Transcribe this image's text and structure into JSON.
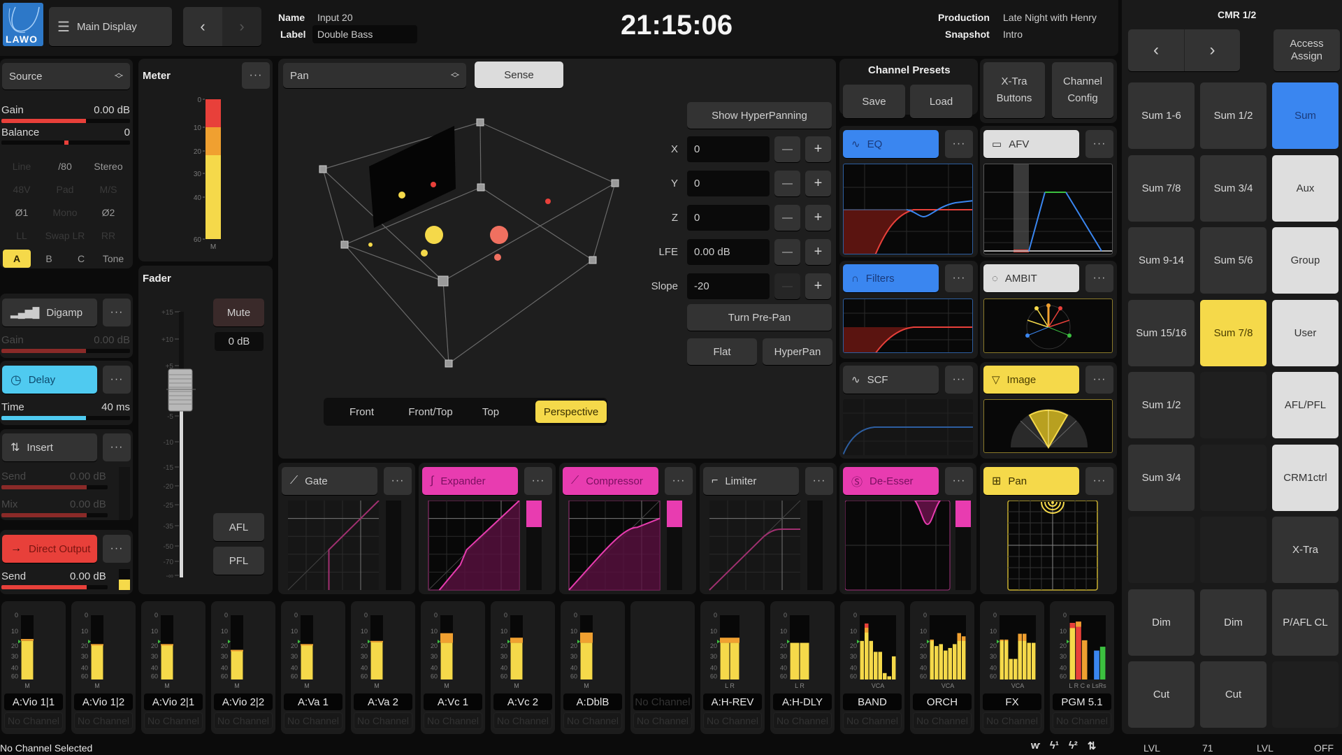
{
  "header": {
    "logo": "LAWO",
    "main_display_label": "Main Display",
    "name_label": "Name",
    "name_value": "Input 20",
    "label_label": "Label",
    "label_value": "Double Bass",
    "clock": "21:15:06",
    "production_label": "Production",
    "production_value": "Late Night with Henry",
    "snapshot_label": "Snapshot",
    "snapshot_value": "Intro"
  },
  "source": {
    "selector": "Source",
    "gain_label": "Gain",
    "gain_value": "0.00 dB",
    "gain_fraction": 0.66,
    "balance_label": "Balance",
    "balance_value": "0",
    "grid": [
      [
        {
          "label": "Line",
          "active": false
        },
        {
          "label": "/80",
          "active": true
        },
        {
          "label": "Stereo",
          "active": true
        }
      ],
      [
        {
          "label": "48V",
          "active": false
        },
        {
          "label": "Pad",
          "active": false
        },
        {
          "label": "M/S",
          "active": false
        }
      ],
      [
        {
          "label": "Ø1",
          "active": true
        },
        {
          "label": "Mono",
          "active": false
        },
        {
          "label": "Ø2",
          "active": true
        }
      ],
      [
        {
          "label": "LL",
          "active": false
        },
        {
          "label": "Swap LR",
          "active": false
        },
        {
          "label": "RR",
          "active": false
        }
      ],
      [
        {
          "label": "A",
          "active": true,
          "selected": true
        },
        {
          "label": "B",
          "active": true
        },
        {
          "label": "C",
          "active": true
        },
        {
          "label": "Tone",
          "active": true
        }
      ]
    ]
  },
  "meter": {
    "title": "Meter",
    "more": "···",
    "scale": [
      "0",
      "10",
      "20",
      "30",
      "40",
      "60"
    ],
    "channel_label": "M"
  },
  "digamp": {
    "label": "Digamp",
    "gain_label": "Gain",
    "gain_value": "0.00 dB",
    "gain_fraction": 0.66
  },
  "delay": {
    "label": "Delay",
    "time_label": "Time",
    "time_value": "40 ms",
    "time_fraction": 0.66
  },
  "insert": {
    "label": "Insert",
    "send_label": "Send",
    "send_value": "0.00 dB",
    "mix_label": "Mix",
    "mix_value": "0.00 dB",
    "send_fraction": 0.8,
    "mix_fraction": 0.8
  },
  "direct_output": {
    "label": "Direct Output",
    "send_label": "Send",
    "send_value": "0.00 dB",
    "send_fraction": 0.8
  },
  "fader": {
    "title": "Fader",
    "scale": [
      "+15",
      "+10",
      "+5",
      "0",
      "-5",
      "-10",
      "-15",
      "-20",
      "-25",
      "-35",
      "-50",
      "-70",
      "-∞"
    ],
    "mute_label": "Mute",
    "level_readout": "0 dB",
    "afl_label": "AFL",
    "pfl_label": "PFL"
  },
  "pan": {
    "selector": "Pan",
    "sense_label": "Sense",
    "show_hyperpanning": "Show HyperPanning",
    "params": [
      {
        "label": "X",
        "value": "0"
      },
      {
        "label": "Y",
        "value": "0"
      },
      {
        "label": "Z",
        "value": "0"
      },
      {
        "label": "LFE",
        "value": "0.00 dB"
      },
      {
        "label": "Slope",
        "value": "-20"
      }
    ],
    "minus": "—",
    "plus": "+",
    "turn_prepan": "Turn Pre-Pan",
    "flat": "Flat",
    "hyperpan": "HyperPan",
    "views": [
      "Front",
      "Front/Top",
      "Top",
      "Perspective"
    ],
    "active_view": "Perspective"
  },
  "presets": {
    "title": "Channel Presets",
    "save": "Save",
    "load": "Load",
    "xtra_buttons": "X-Tra Buttons",
    "channel_config": "Channel Config"
  },
  "modules": {
    "eq": "EQ",
    "afv": "AFV",
    "filters": "Filters",
    "ambit": "AMBIT",
    "scf": "SCF",
    "image": "Image",
    "gate": "Gate",
    "expander": "Expander",
    "compressor": "Compressor",
    "limiter": "Limiter",
    "deesser": "De-Esser",
    "pan": "Pan",
    "more": "···"
  },
  "strips": [
    {
      "name": "A:Vio 1|1",
      "sub": "No Channel",
      "type": "mono",
      "levels": [
        0.6
      ],
      "peak": 0.63,
      "labels": "M"
    },
    {
      "name": "A:Vio 1|2",
      "sub": "No Channel",
      "type": "mono",
      "levels": [
        0.55
      ],
      "peak": 0.55,
      "labels": "M"
    },
    {
      "name": "A:Vio 2|1",
      "sub": "No Channel",
      "type": "mono",
      "levels": [
        0.55
      ],
      "peak": 0.55,
      "labels": "M"
    },
    {
      "name": "A:Vio 2|2",
      "sub": "No Channel",
      "type": "mono",
      "levels": [
        0.46
      ],
      "peak": 0.46,
      "labels": "M"
    },
    {
      "name": "A:Va 1",
      "sub": "No Channel",
      "type": "mono",
      "levels": [
        0.55
      ],
      "peak": 0.55,
      "labels": "M"
    },
    {
      "name": "A:Va 2",
      "sub": "No Channel",
      "type": "mono",
      "levels": [
        0.58
      ],
      "peak": 0.6,
      "labels": "M"
    },
    {
      "name": "A:Vc 1",
      "sub": "No Channel",
      "type": "mono",
      "levels": [
        0.57
      ],
      "peak": 0.72,
      "labels": "M"
    },
    {
      "name": "A:Vc 2",
      "sub": "No Channel",
      "type": "mono",
      "levels": [
        0.57
      ],
      "peak": 0.65,
      "labels": "M"
    },
    {
      "name": "A:DblB",
      "sub": "No Channel",
      "type": "mono",
      "levels": [
        0.57
      ],
      "peak": 0.73,
      "labels": "M"
    },
    {
      "name": "No Channel",
      "sub": "No Channel",
      "type": "empty",
      "levels": [],
      "labels": ""
    },
    {
      "name": "A:H-REV",
      "sub": "No Channel",
      "type": "stereo",
      "levels": [
        0.57,
        0.57
      ],
      "peak": 0.65,
      "labels": "L R"
    },
    {
      "name": "A:H-DLY",
      "sub": "No Channel",
      "type": "stereo",
      "levels": [
        0.57,
        0.57
      ],
      "peak": 0.57,
      "labels": "L R"
    },
    {
      "name": "BAND",
      "sub": "No Channel",
      "type": "vca",
      "levels": [
        0.6,
        0.87,
        0.6,
        0.43,
        0.43,
        0.1,
        0.05,
        0.36
      ],
      "labels": "VCA"
    },
    {
      "name": "ORCH",
      "sub": "No Channel",
      "type": "vca",
      "levels": [
        0.62,
        0.52,
        0.55,
        0.45,
        0.49,
        0.55,
        0.72,
        0.67
      ],
      "labels": "VCA"
    },
    {
      "name": "FX",
      "sub": "No Channel",
      "type": "vca",
      "levels": [
        0.62,
        0.62,
        0.32,
        0.32,
        0.71,
        0.71,
        0.57,
        0.57
      ],
      "labels": "VCA"
    },
    {
      "name": "PGM 5.1",
      "sub": "No Channel",
      "type": "surround",
      "levels": [
        0.88,
        0.9,
        0.61,
        0,
        0.45,
        0.51
      ],
      "labels": "L R C e LsRs"
    }
  ],
  "cmr": {
    "title": "CMR 1/2",
    "prev": "‹",
    "next": "›",
    "access_assign": "Access Assign",
    "grid": [
      [
        {
          "label": "Sum 1-6",
          "style": "dark"
        },
        {
          "label": "Sum 1/2",
          "style": "dark"
        },
        {
          "label": "Sum",
          "style": "blue"
        }
      ],
      [
        {
          "label": "Sum 7/8",
          "style": "dark"
        },
        {
          "label": "Sum 3/4",
          "style": "dark"
        },
        {
          "label": "Aux",
          "style": "light"
        }
      ],
      [
        {
          "label": "Sum 9-14",
          "style": "dark"
        },
        {
          "label": "Sum 5/6",
          "style": "dark"
        },
        {
          "label": "Group",
          "style": "light"
        }
      ],
      [
        {
          "label": "Sum 15/16",
          "style": "dark"
        },
        {
          "label": "Sum 7/8",
          "style": "yellow"
        },
        {
          "label": "User",
          "style": "light"
        }
      ],
      [
        {
          "label": "Sum 1/2",
          "style": "dark"
        },
        {
          "label": "",
          "style": "empty"
        },
        {
          "label": "AFL/PFL",
          "style": "light"
        }
      ],
      [
        {
          "label": "Sum 3/4",
          "style": "dark"
        },
        {
          "label": "",
          "style": "empty"
        },
        {
          "label": "CRM1ctrl",
          "style": "light"
        }
      ],
      [
        {
          "label": "",
          "style": "empty"
        },
        {
          "label": "",
          "style": "empty"
        },
        {
          "label": "X-Tra",
          "style": "dark"
        }
      ],
      [
        {
          "label": "Dim",
          "style": "dark"
        },
        {
          "label": "Dim",
          "style": "dark"
        },
        {
          "label": "P/AFL CL",
          "style": "dark"
        }
      ],
      [
        {
          "label": "Cut",
          "style": "dark"
        },
        {
          "label": "Cut",
          "style": "dark"
        },
        {
          "label": "",
          "style": "empty"
        }
      ]
    ]
  },
  "status": {
    "left": "No Channel Selected",
    "icons": [
      "meters-icon",
      "bolt-1-icon",
      "bolt-2-icon",
      "swap-arrows-icon"
    ],
    "readouts": [
      "LVL",
      "71",
      "LVL",
      "OFF"
    ]
  },
  "colors": {
    "accent_blue": "#3a86f0",
    "accent_cyan": "#4fcaf0",
    "accent_yellow": "#f5d94a",
    "accent_magenta": "#e83cb0",
    "accent_red": "#e8403a",
    "meter_orange": "#f0a030"
  }
}
